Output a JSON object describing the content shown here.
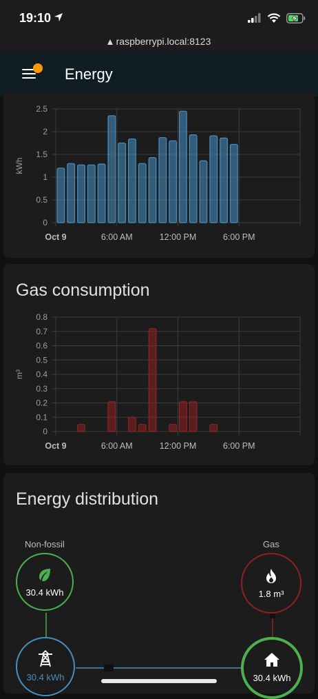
{
  "status_bar": {
    "time": "19:10"
  },
  "url_bar": {
    "url": "raspberrypi.local:8123"
  },
  "app_bar": {
    "title": "Energy"
  },
  "electricity_chart": {
    "ylabel": "kWh",
    "y_ticks": [
      "2.5",
      "2",
      "1.5",
      "1",
      "0.5",
      "0"
    ],
    "x_ticks": [
      "Oct 9",
      "6:00 AM",
      "12:00 PM",
      "6:00 PM"
    ]
  },
  "gas_chart": {
    "title": "Gas consumption",
    "ylabel": "m³",
    "y_ticks": [
      "0.8",
      "0.7",
      "0.6",
      "0.5",
      "0.4",
      "0.3",
      "0.2",
      "0.1",
      "0"
    ],
    "x_ticks": [
      "Oct 9",
      "6:00 AM",
      "12:00 PM",
      "6:00 PM"
    ]
  },
  "distribution": {
    "title": "Energy distribution",
    "non_fossil": {
      "label": "Non-fossil",
      "value": "30.4 kWh",
      "icon": "leaf-icon",
      "color": "#4caf50"
    },
    "gas": {
      "label": "Gas",
      "value": "1.8 m³",
      "icon": "fire-icon",
      "color": "#8e2121"
    },
    "grid": {
      "value": "30.4 kWh",
      "icon": "transmission-tower-icon",
      "color": "#488fc2"
    },
    "home": {
      "value": "30.4 kWh",
      "icon": "home-icon",
      "color": "#4caf50"
    }
  },
  "colors": {
    "electricity": "#488fc2",
    "gas": "#8e2121",
    "background": "#111111",
    "card": "#1c1c1c"
  },
  "chart_data": [
    {
      "type": "bar",
      "x": [
        "00:00",
        "01:00",
        "02:00",
        "03:00",
        "04:00",
        "05:00",
        "06:00",
        "07:00",
        "08:00",
        "09:00",
        "10:00",
        "11:00",
        "12:00",
        "13:00",
        "14:00",
        "15:00",
        "16:00",
        "17:00",
        "18:00",
        "19:00",
        "20:00",
        "21:00",
        "22:00",
        "23:00"
      ],
      "values": [
        1.2,
        1.3,
        1.27,
        1.27,
        1.29,
        2.35,
        1.75,
        1.84,
        1.3,
        1.43,
        1.87,
        1.8,
        2.45,
        1.93,
        1.36,
        1.91,
        1.86,
        1.72,
        null,
        null,
        null,
        null,
        null,
        null
      ],
      "xlabel": "",
      "ylabel": "kWh",
      "ylim": [
        0,
        2.5
      ],
      "grid": true,
      "color": "#488fc2"
    },
    {
      "type": "bar",
      "title": "Gas consumption",
      "x": [
        "00:00",
        "01:00",
        "02:00",
        "03:00",
        "04:00",
        "05:00",
        "06:00",
        "07:00",
        "08:00",
        "09:00",
        "10:00",
        "11:00",
        "12:00",
        "13:00",
        "14:00",
        "15:00",
        "16:00",
        "17:00",
        "18:00",
        "19:00",
        "20:00",
        "21:00",
        "22:00",
        "23:00"
      ],
      "values": [
        0,
        0,
        0.05,
        0,
        0,
        0.21,
        0,
        0.1,
        0.05,
        0.72,
        0,
        0.05,
        0.21,
        0.21,
        0,
        0.05,
        0,
        0,
        0,
        0,
        0,
        0,
        0,
        0
      ],
      "xlabel": "",
      "ylabel": "m³",
      "ylim": [
        0,
        0.8
      ],
      "grid": true,
      "color": "#8e2121"
    }
  ]
}
